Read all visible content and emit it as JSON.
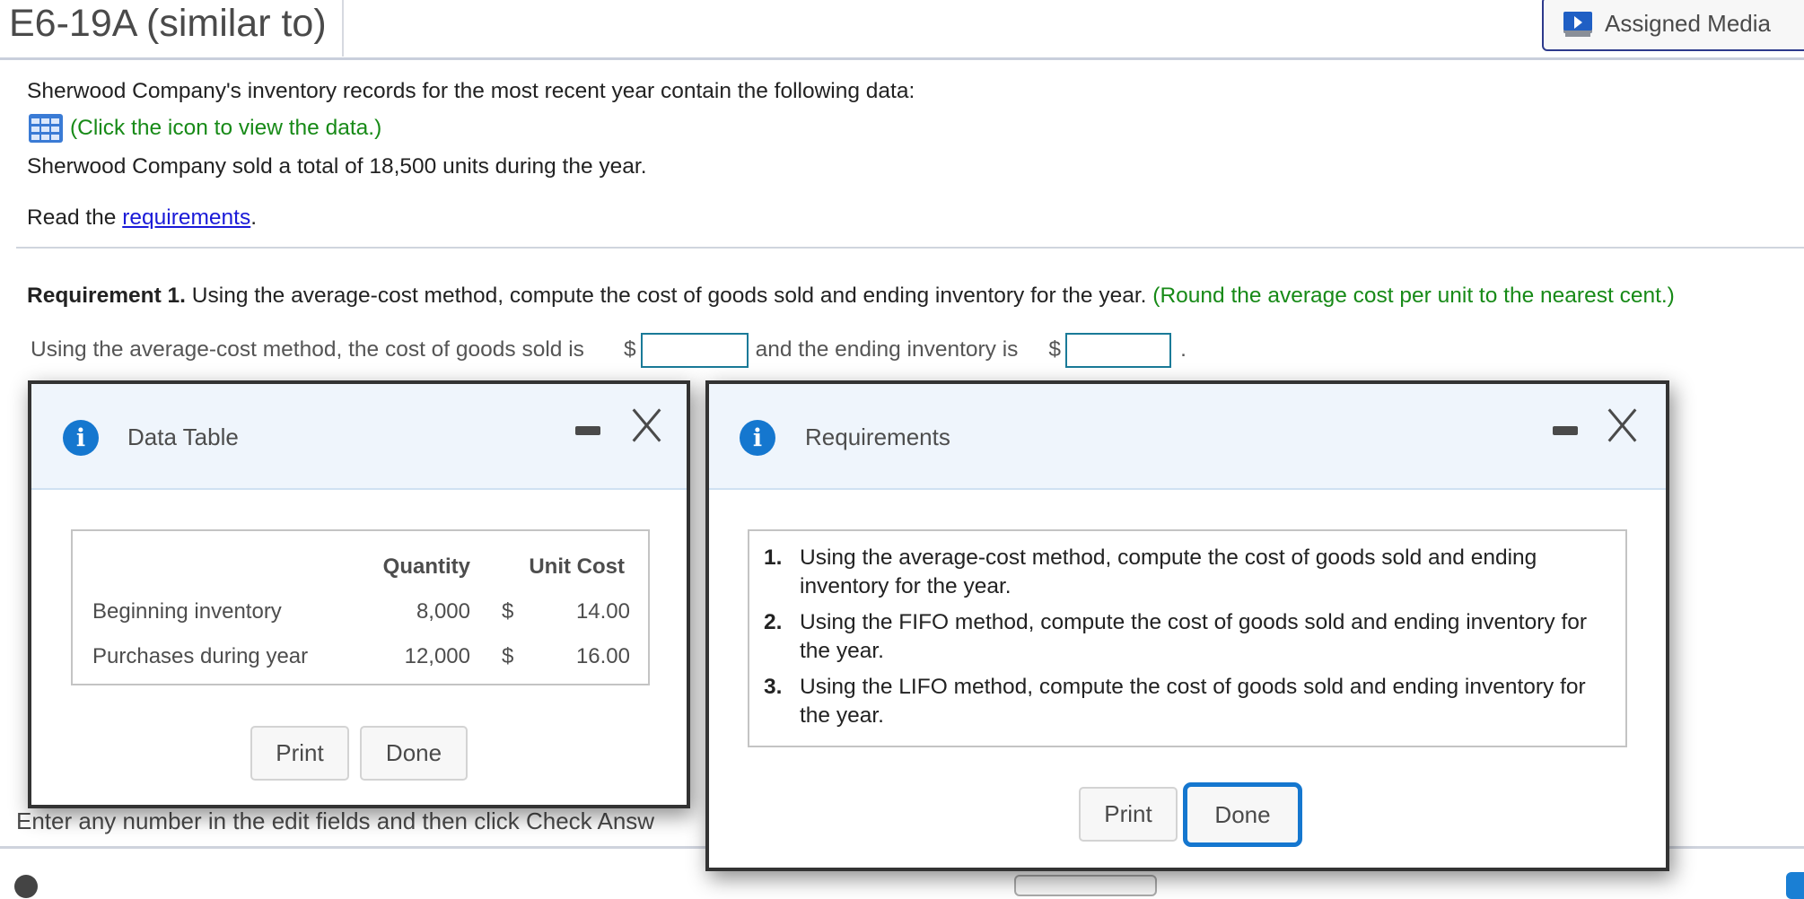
{
  "header": {
    "title": "E6-19A (similar to)",
    "assigned_media_label": "Assigned Media",
    "assigned_media_icon": "media-player-icon"
  },
  "problem": {
    "intro": "Sherwood Company's inventory records for the most recent year contain the following data:",
    "data_icon": "grid-table-icon",
    "data_link": "(Click the icon to view the data.)",
    "units_sold": "Sherwood Company sold a total of 18,500 units during the year.",
    "read_prefix": "Read the ",
    "read_link": "requirements",
    "read_suffix": "."
  },
  "requirement1": {
    "label": "Requirement 1.",
    "text": " Using the average-cost method, compute the cost of goods sold and ending inventory for the year. ",
    "hint": "(Round the average cost per unit to the nearest cent.)",
    "answer_prefix": "Using the average-cost method, the cost of goods sold is",
    "dollar": "$",
    "answer_middle": "and the ending inventory is",
    "answer_suffix": ".",
    "cogs_value": "",
    "ending_inventory_value": ""
  },
  "footer": {
    "instruction": "Enter any number in the edit fields and then click Check Answ"
  },
  "data_dialog": {
    "title": "Data Table",
    "info_icon": "i",
    "columns": [
      "",
      "Quantity",
      "Unit Cost"
    ],
    "rows": [
      {
        "label": "Beginning inventory",
        "quantity": "8,000",
        "currency": "$",
        "unit_cost": "14.00"
      },
      {
        "label": "Purchases during year",
        "quantity": "12,000",
        "currency": "$",
        "unit_cost": "16.00"
      }
    ],
    "print_label": "Print",
    "done_label": "Done"
  },
  "requirements_dialog": {
    "title": "Requirements",
    "info_icon": "i",
    "items": [
      {
        "num": "1.",
        "text": "Using the average-cost method, compute the cost of goods sold and ending inventory for the year."
      },
      {
        "num": "2.",
        "text": "Using the FIFO method, compute the cost of goods sold and ending inventory for the year."
      },
      {
        "num": "3.",
        "text": "Using the LIFO method, compute the cost of goods sold and ending inventory for the year."
      }
    ],
    "print_label": "Print",
    "done_label": "Done"
  },
  "colors": {
    "accent_blue": "#1577cf",
    "hint_green": "#178a17",
    "link_blue": "#1a1ad8",
    "input_border": "#1a7a98",
    "dialog_header_bg": "#eff5fc"
  }
}
